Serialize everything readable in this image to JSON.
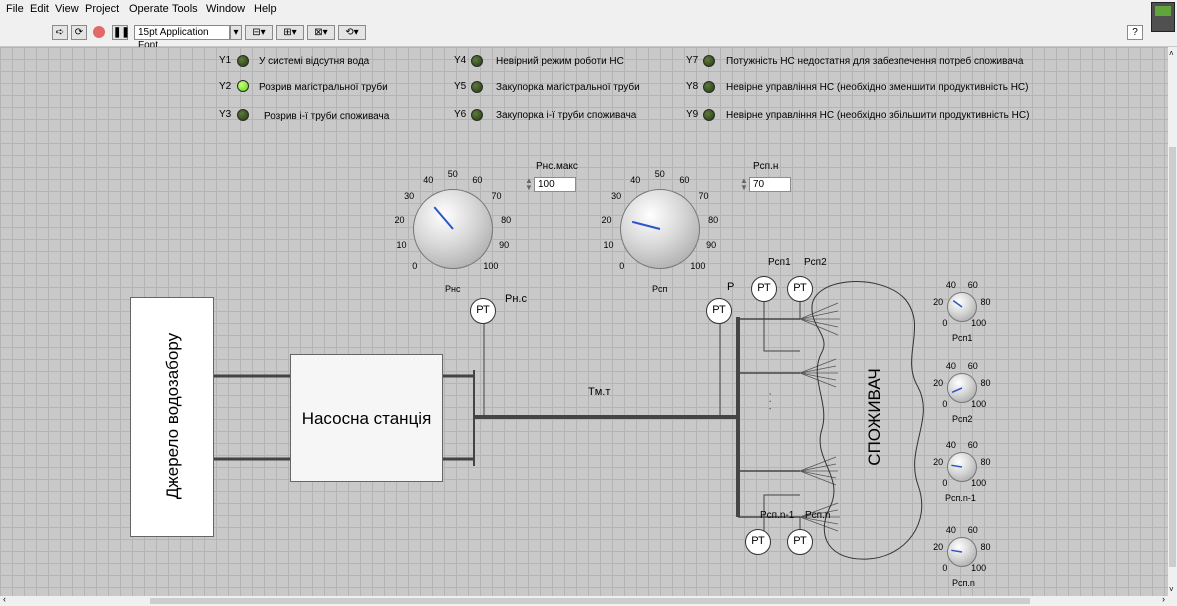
{
  "menu": [
    "File",
    "Edit",
    "View",
    "Project",
    "Operate",
    "Tools",
    "Window",
    "Help"
  ],
  "toolbar": {
    "font_label": "15pt Application Font",
    "help_label": "?"
  },
  "indicators": [
    {
      "id": "Y1",
      "label": "У системі відсутня вода",
      "state": "off"
    },
    {
      "id": "Y2",
      "label": "Розрив магістральної труби",
      "state": "on"
    },
    {
      "id": "Y3",
      "label": "Розрив і-ї труби споживача",
      "state": "off"
    },
    {
      "id": "Y4",
      "label": "Невірний режим роботи НС",
      "state": "off"
    },
    {
      "id": "Y5",
      "label": "Закупорка магістральної труби",
      "state": "off"
    },
    {
      "id": "Y6",
      "label": "Закупорка і-ї труби споживача",
      "state": "off"
    },
    {
      "id": "Y7",
      "label": "Потужність НС недостатня для забезпечення потреб споживача",
      "state": "off"
    },
    {
      "id": "Y8",
      "label": "Невірне управління НС (необхідно зменшити продуктивність НС)",
      "state": "off"
    },
    {
      "id": "Y9",
      "label": "Невірне управління НС (необхідно збільшити продуктивність НС)",
      "state": "off"
    }
  ],
  "knobs": {
    "pnc": {
      "label": "Рнс",
      "value": 35
    },
    "pcp": {
      "label": "Рсп",
      "value": 22
    },
    "pcp1": {
      "label": "Рсп1",
      "value": 30
    },
    "pcp2": {
      "label": "Рсп2",
      "value": 8
    },
    "pcpn1": {
      "label": "Рсп.n-1",
      "value": 20
    },
    "pcpn": {
      "label": "Рсп.n",
      "value": 20
    }
  },
  "big_ticks": [
    "0",
    "10",
    "20",
    "30",
    "40",
    "50",
    "60",
    "70",
    "80",
    "90",
    "100"
  ],
  "small_ticks": [
    "0",
    "20",
    "40",
    "60",
    "80",
    "100"
  ],
  "controls": {
    "pnc_max": {
      "label": "Рнс.макс",
      "value": "100"
    },
    "pcp_n": {
      "label": "Рсп.н",
      "value": "70"
    }
  },
  "diagram": {
    "source": "Джерело водозабору",
    "station": "Насосна станція",
    "consumer": "СПОЖИВАЧ",
    "sensor": "РТ",
    "label_p_ns": "Pн.с",
    "label_p": "P",
    "label_t": "Tм.т",
    "label_p1": "Pсп1",
    "label_p2": "Pсп2",
    "label_pn1": "Pсп.n-1",
    "label_pn": "Pсп.n",
    "dots": "· · ·"
  }
}
